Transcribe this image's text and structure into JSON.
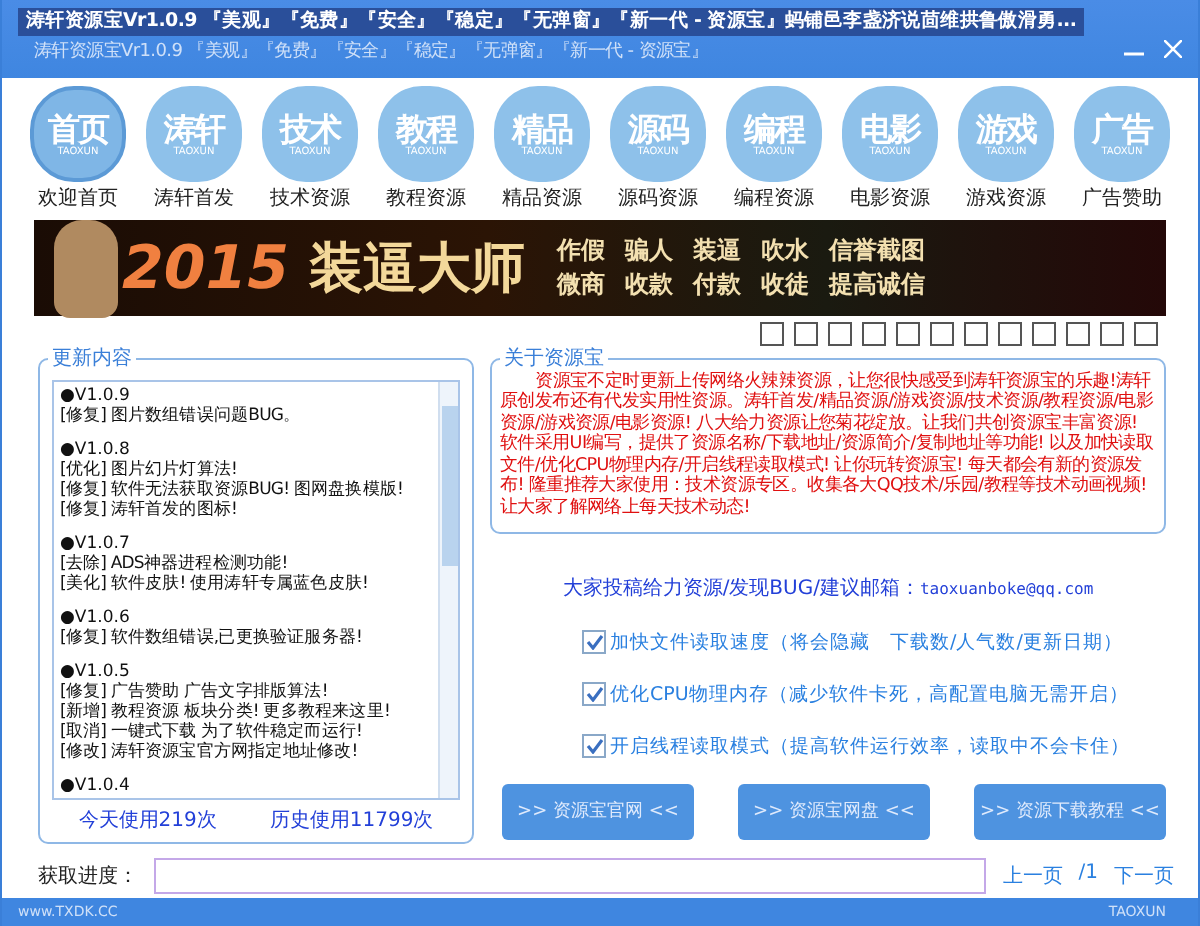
{
  "window": {
    "title": "涛轩资源宝Vr1.0.9  『美观』『免费』『安全』『稳定』『无弹窗』『新一代 - 资源宝』蚂铺邑李盏济说茴维拱鲁傲滑勇...",
    "subtitle": "涛轩资源宝Vr1.0.9  『美观』『免费』『安全』『稳定』『无弹窗』『新一代 - 资源宝』"
  },
  "nav": [
    {
      "glyph": "首页",
      "tag": "TAOXUN",
      "label": "欢迎首页",
      "selected": true
    },
    {
      "glyph": "涛轩",
      "tag": "TAOXUN",
      "label": "涛轩首发",
      "selected": false
    },
    {
      "glyph": "技术",
      "tag": "TAOXUN",
      "label": "技术资源",
      "selected": false
    },
    {
      "glyph": "教程",
      "tag": "TAOXUN",
      "label": "教程资源",
      "selected": false
    },
    {
      "glyph": "精品",
      "tag": "TAOXUN",
      "label": "精品资源",
      "selected": false
    },
    {
      "glyph": "源码",
      "tag": "TAOXUN",
      "label": "源码资源",
      "selected": false
    },
    {
      "glyph": "编程",
      "tag": "TAOXUN",
      "label": "编程资源",
      "selected": false
    },
    {
      "glyph": "电影",
      "tag": "TAOXUN",
      "label": "电影资源",
      "selected": false
    },
    {
      "glyph": "游戏",
      "tag": "TAOXUN",
      "label": "游戏资源",
      "selected": false
    },
    {
      "glyph": "广告",
      "tag": "TAOXUN",
      "label": "广告赞助",
      "selected": false
    }
  ],
  "banner": {
    "year": "2015",
    "headline": "装逼大师",
    "words": [
      "作假",
      "骗人",
      "装逼",
      "吹水",
      "信誉截图",
      "微商",
      "收款",
      "付款",
      "收徒",
      "提高诚信"
    ]
  },
  "changelog": {
    "title": "更新内容",
    "entries": [
      {
        "version": "●V1.0.9",
        "lines": [
          "[修复] 图片数组错误问题BUG。"
        ]
      },
      {
        "version": "●V1.0.8",
        "lines": [
          "[优化] 图片幻片灯算法!",
          "[修复] 软件无法获取资源BUG! 图网盘换模版!",
          "[修复] 涛轩首发的图标!"
        ]
      },
      {
        "version": "●V1.0.7",
        "lines": [
          "[去除] ADS神器进程检测功能!",
          "[美化] 软件皮肤! 使用涛轩专属蓝色皮肤!"
        ]
      },
      {
        "version": "●V1.0.6",
        "lines": [
          "[修复] 软件数组错误,已更换验证服务器!"
        ]
      },
      {
        "version": "●V1.0.5",
        "lines": [
          "[修复] 广告赞助 广告文字排版算法!",
          "[新增] 教程资源 板块分类! 更多教程来这里!",
          "[取消] 一键式下载 为了软件稳定而运行!",
          "[修改] 涛轩资源宝官方网指定地址修改!"
        ]
      },
      {
        "version": "●V1.0.4"
      }
    ],
    "today": "今天使用219次",
    "total": "历史使用11799次"
  },
  "about": {
    "title": "关于资源宝",
    "text": "资源宝不定时更新上传网络火辣辣资源，让您很快感受到涛轩资源宝的乐趣!涛轩原创发布还有代发实用性资源。涛轩首发/精品资源/游戏资源/技术资源/教程资源/电影资源/游戏资源/电影资源! 八大给力资源让您菊花绽放。让我们共创资源宝丰富资源! 软件采用UI编写，提供了资源名称/下载地址/资源简介/复制地址等功能! 以及加快读取文件/优化CPU物理内存/开启线程读取模式! 让你玩转资源宝! 每天都会有新的资源发布! 隆重推荐大家使用：技术资源专区。收集各大QQ技术/乐园/教程等技术动画视频! 让大家了解网络上每天技术动态!"
  },
  "contact": {
    "label": "大家投稿给力资源/发现BUG/建议邮箱：",
    "email": "taoxuanboke@qq.com"
  },
  "options": [
    {
      "label": "加快文件读取速度（将会隐藏　下载数/人气数/更新日期）",
      "checked": true
    },
    {
      "label": "优化CPU物理内存（减少软件卡死，高配置电脑无需开启）",
      "checked": true
    },
    {
      "label": "开启线程读取模式（提高软件运行效率，读取中不会卡住）",
      "checked": true
    }
  ],
  "buttons": [
    ">> 资源宝官网 <<",
    ">> 资源宝网盘 <<",
    ">> 资源下载教程 <<"
  ],
  "progress": {
    "label": "获取进度："
  },
  "pager": {
    "prev": "上一页",
    "page": "/1",
    "next": "下一页"
  },
  "status_bar": {
    "site": "www.TXDK.CC",
    "tag": "TAOXUN"
  }
}
